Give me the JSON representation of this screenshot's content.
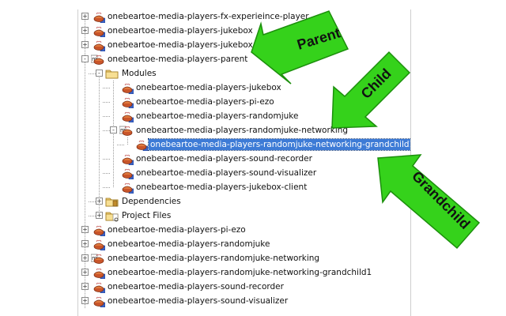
{
  "tree": {
    "rows": [
      {
        "label": "onebeartoe-media-players-fx-experieince-player",
        "level": 0,
        "toggle": "+",
        "icon": "maven"
      },
      {
        "label": "onebeartoe-media-players-jukebox",
        "level": 0,
        "toggle": "+",
        "icon": "maven"
      },
      {
        "label": "onebeartoe-media-players-jukebox",
        "level": 0,
        "toggle": "+",
        "icon": "maven"
      },
      {
        "label": "onebeartoe-media-players-parent",
        "level": 0,
        "toggle": "-",
        "icon": "maven-parent"
      },
      {
        "label": "Modules",
        "level": 1,
        "toggle": "-",
        "icon": "folder"
      },
      {
        "label": "onebeartoe-media-players-jukebox",
        "level": 2,
        "toggle": "",
        "icon": "maven"
      },
      {
        "label": "onebeartoe-media-players-pi-ezo",
        "level": 2,
        "toggle": "",
        "icon": "maven"
      },
      {
        "label": "onebeartoe-media-players-randomjuke",
        "level": 2,
        "toggle": "",
        "icon": "maven"
      },
      {
        "label": "onebeartoe-media-players-randomjuke-networking",
        "level": 2,
        "toggle": "-",
        "icon": "maven-parent"
      },
      {
        "label": "onebeartoe-media-players-randomjuke-networking-grandchild1",
        "level": 3,
        "toggle": "",
        "icon": "maven",
        "selected": true
      },
      {
        "label": "onebeartoe-media-players-sound-recorder",
        "level": 2,
        "toggle": "",
        "icon": "maven"
      },
      {
        "label": "onebeartoe-media-players-sound-visualizer",
        "level": 2,
        "toggle": "",
        "icon": "maven"
      },
      {
        "label": "onebeartoe-media-players-jukebox-client",
        "level": 2,
        "toggle": "",
        "icon": "maven"
      },
      {
        "label": "Dependencies",
        "level": 1,
        "toggle": "+",
        "icon": "folder-lib"
      },
      {
        "label": "Project Files",
        "level": 1,
        "toggle": "+",
        "icon": "folder-files"
      },
      {
        "label": "onebeartoe-media-players-pi-ezo",
        "level": 0,
        "toggle": "+",
        "icon": "maven"
      },
      {
        "label": "onebeartoe-media-players-randomjuke",
        "level": 0,
        "toggle": "+",
        "icon": "maven"
      },
      {
        "label": "onebeartoe-media-players-randomjuke-networking",
        "level": 0,
        "toggle": "+",
        "icon": "maven-parent"
      },
      {
        "label": "onebeartoe-media-players-randomjuke-networking-grandchild1",
        "level": 0,
        "toggle": "+",
        "icon": "maven"
      },
      {
        "label": "onebeartoe-media-players-sound-recorder",
        "level": 0,
        "toggle": "+",
        "icon": "maven"
      },
      {
        "label": "onebeartoe-media-players-sound-visualizer",
        "level": 0,
        "toggle": "+",
        "icon": "maven"
      }
    ]
  },
  "annotations": {
    "parent": "Parent",
    "child": "Child",
    "grandchild": "Grandchild",
    "arrow_color": "#35d21b",
    "arrow_stroke": "#1c8f0c"
  }
}
